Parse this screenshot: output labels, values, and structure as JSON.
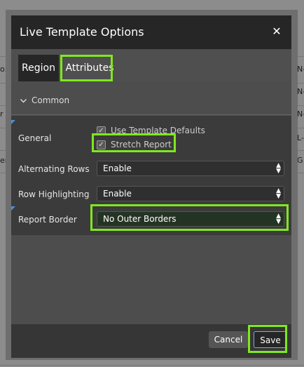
{
  "background": {
    "left_fragments": [
      "o.",
      "r P",
      "ers"
    ],
    "right_fragments": [
      "UN-",
      "UN-",
      "UN-",
      "UL-",
      "UG"
    ]
  },
  "dialog": {
    "title": "Live Template Options",
    "close_glyph": "✕",
    "tabs": [
      {
        "label": "Region",
        "active": true
      },
      {
        "label": "Attributes",
        "active": false
      }
    ],
    "section": {
      "title": "Common",
      "chevron": "❯"
    },
    "general": {
      "label": "General",
      "checkboxes": [
        {
          "label": "Use Template Defaults",
          "checked": true
        },
        {
          "label": "Stretch Report",
          "checked": true
        }
      ]
    },
    "alternating_rows": {
      "label": "Alternating Rows",
      "value": "Enable"
    },
    "row_highlighting": {
      "label": "Row Highlighting",
      "value": "Enable"
    },
    "report_border": {
      "label": "Report Border",
      "value": "No Outer Borders"
    },
    "footer": {
      "cancel_label": "Cancel",
      "save_label": "Save"
    }
  },
  "colors": {
    "highlight": "#7fe81e",
    "marker": "#4a90d9"
  },
  "icons": {
    "close": "close-icon",
    "chevron": "chevron-right-icon",
    "check": "checkmark-icon",
    "select_arrows": "up-down-arrows-icon"
  }
}
